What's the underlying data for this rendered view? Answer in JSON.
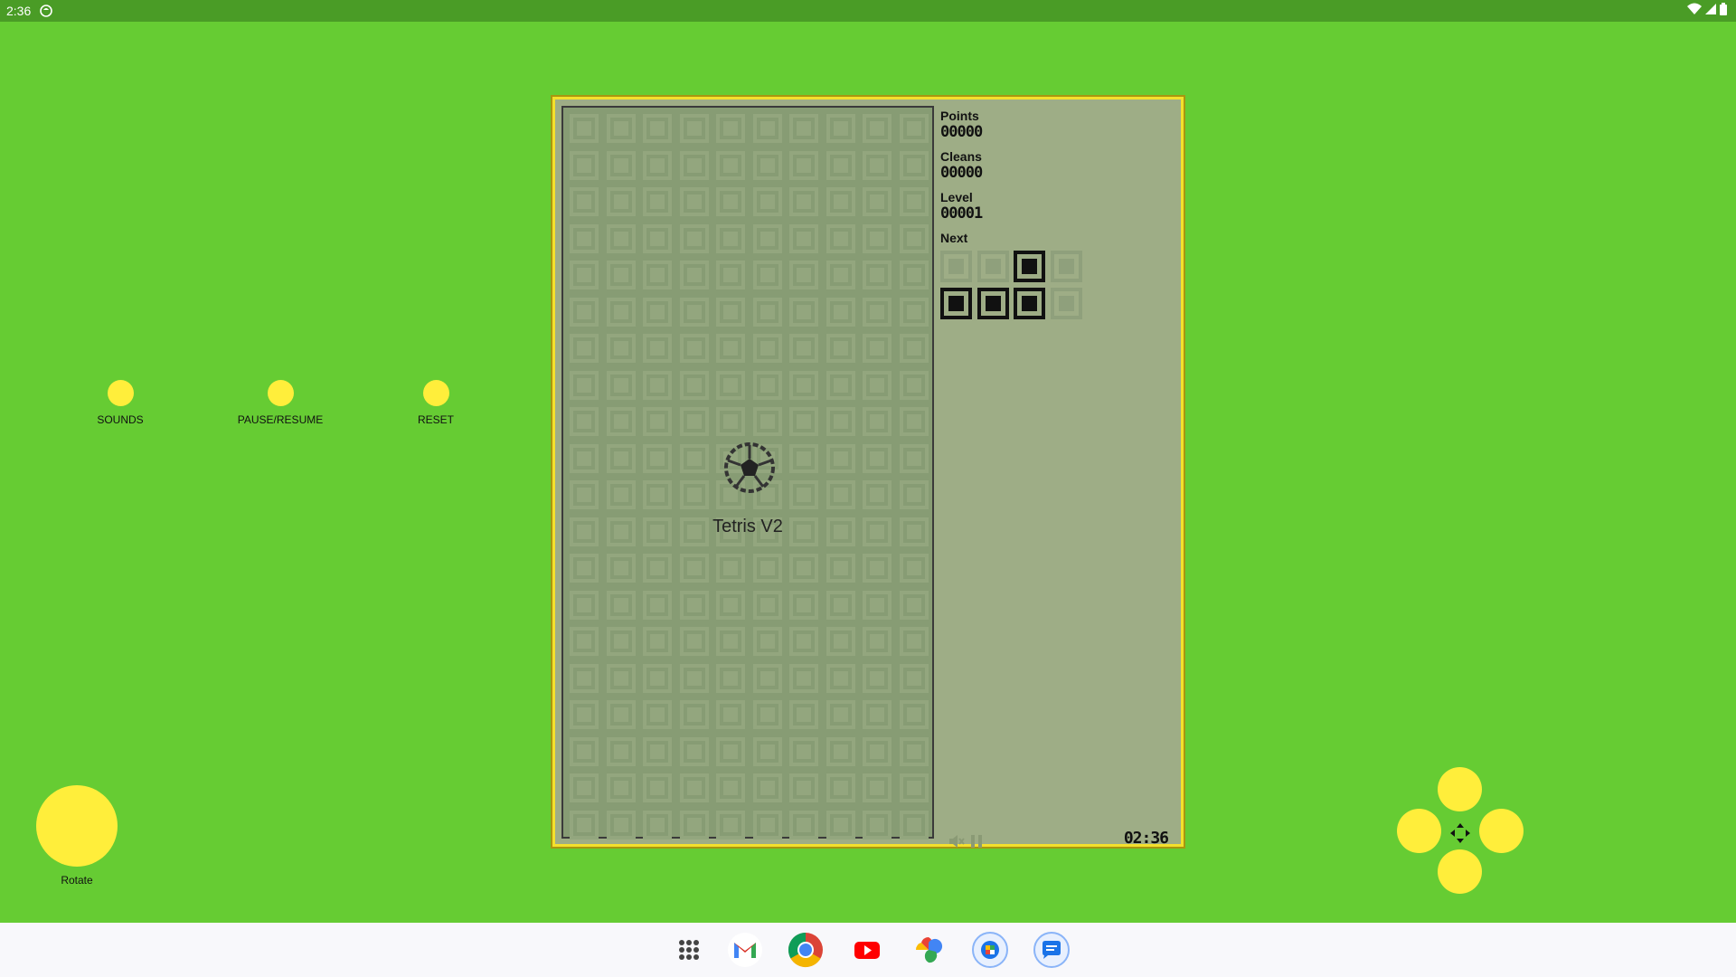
{
  "status_bar": {
    "time": "2:36"
  },
  "controls": {
    "sounds_label": "SOUNDS",
    "pause_label": "PAUSE/RESUME",
    "reset_label": "RESET",
    "rotate_label": "Rotate"
  },
  "game": {
    "title": "Tetris V2",
    "points_label": "Points",
    "points_value": "00000",
    "cleans_label": "Cleans",
    "cleans_value": "00000",
    "level_label": "Level",
    "level_value": "00001",
    "next_label": "Next",
    "next_piece": [
      [
        0,
        0,
        1,
        0
      ],
      [
        1,
        1,
        1,
        0
      ]
    ],
    "clock": "02:36",
    "board_cols": 10,
    "board_rows": 20
  },
  "taskbar": {
    "apps": [
      "app-drawer",
      "gmail",
      "chrome",
      "youtube",
      "photos",
      "maps-app",
      "messages"
    ]
  },
  "colors": {
    "background": "#66cc33",
    "button": "#ffee3b",
    "screen": "#9ead86",
    "frame": "#f4e02c"
  }
}
